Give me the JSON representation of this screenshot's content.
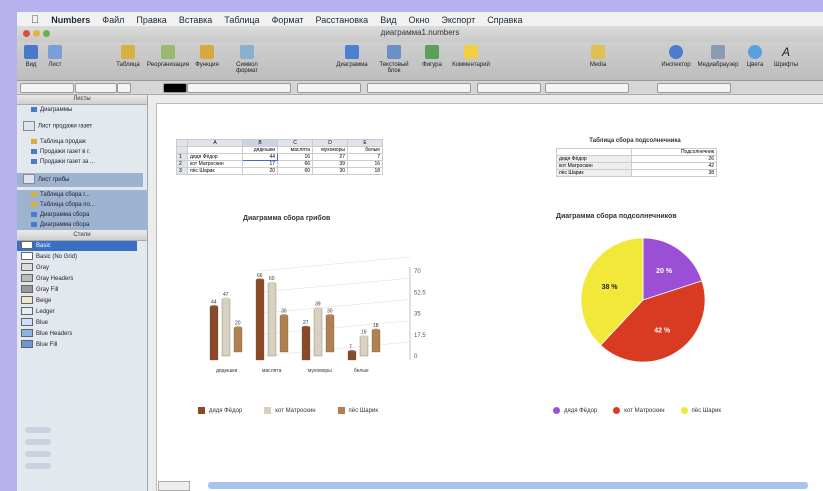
{
  "menubar": {
    "app": "Numbers",
    "items": [
      "Файл",
      "Правка",
      "Вставка",
      "Таблица",
      "Формат",
      "Расстановка",
      "Вид",
      "Окно",
      "Экспорт",
      "Справка"
    ]
  },
  "window": {
    "title": "диаграмма1.numbers"
  },
  "toolbar": {
    "items": [
      "Вид",
      "Лист",
      "Таблица",
      "Реорганизация",
      "Функция",
      "Символ формат",
      "Диаграмма",
      "Текстовый блок",
      "Фигура",
      "Комментарий",
      "Media",
      "Инспектор",
      "Медиабраузер",
      "Цвета",
      "Шрифты"
    ]
  },
  "sidebar": {
    "sheets_header": "Листы",
    "styles_header": "Стили",
    "sheet_items": [
      "Диаграммы",
      "Лист продажи газет",
      "Таблица продаж",
      "Продажи газет в г.",
      "Продажи газет за ...",
      "Лист грибы",
      "Таблица сбора г...",
      "Таблица сбора по...",
      "Диаграмма сбора",
      "Диаграмма сбора"
    ],
    "styles": [
      "Basic",
      "Basic (No Grid)",
      "Gray",
      "Gray Headers",
      "Gray Fill",
      "Beige",
      "Ledger",
      "Blue",
      "Blue Headers",
      "Blue Fill"
    ]
  },
  "table1": {
    "col_letters": [
      "A",
      "B",
      "C",
      "D",
      "E"
    ],
    "headers": [
      "",
      "дядюшки",
      "маслята",
      "мухоморы",
      "белые"
    ],
    "rows": [
      {
        "n": "1",
        "label": "дядя Фёдор",
        "values": [
          "44",
          "16",
          "27",
          "7"
        ]
      },
      {
        "n": "2",
        "label": "кот Матроскин",
        "values": [
          "17",
          "66",
          "39",
          "16"
        ]
      },
      {
        "n": "3",
        "label": "пёс Шарик",
        "values": [
          "20",
          "60",
          "30",
          "18"
        ]
      }
    ]
  },
  "table2": {
    "title": "Таблица сбора подсолнечника",
    "header": "Подсолнечник",
    "rows": [
      {
        "label": "дядя Фёдор",
        "value": "26"
      },
      {
        "label": "кот Матроскин",
        "value": "42"
      },
      {
        "label": "пёс Шарик",
        "value": "38"
      }
    ]
  },
  "chart_data": [
    {
      "type": "bar",
      "title": "Диаграмма сбора грибов",
      "categories": [
        "дядюшки",
        "маслята",
        "мухоморы",
        "белые"
      ],
      "series": [
        {
          "name": "дядя Фёдор",
          "values": [
            44,
            66,
            27,
            7
          ]
        },
        {
          "name": "кот Матроскин",
          "values": [
            47,
            60,
            39,
            16
          ]
        },
        {
          "name": "пёс Шарик",
          "values": [
            20,
            30,
            30,
            18
          ]
        }
      ],
      "y_ticks": [
        "0",
        "17.5",
        "35",
        "52.5",
        "70"
      ],
      "ylim": [
        0,
        70
      ],
      "legend": "bottom",
      "colors": [
        "#8a4a2a",
        "#d8d0c0",
        "#b08050"
      ]
    },
    {
      "type": "pie",
      "title": "Диаграмма сбора подсолнечников",
      "labels": [
        "дядя Фёдор",
        "кот Матроскин",
        "пёс Шарик"
      ],
      "values": [
        20,
        42,
        38
      ],
      "value_labels": [
        "20 %",
        "42 %",
        "38 %"
      ],
      "legend": "bottom",
      "colors": [
        "#9b4fd6",
        "#d93a22",
        "#f2e83a"
      ]
    }
  ]
}
